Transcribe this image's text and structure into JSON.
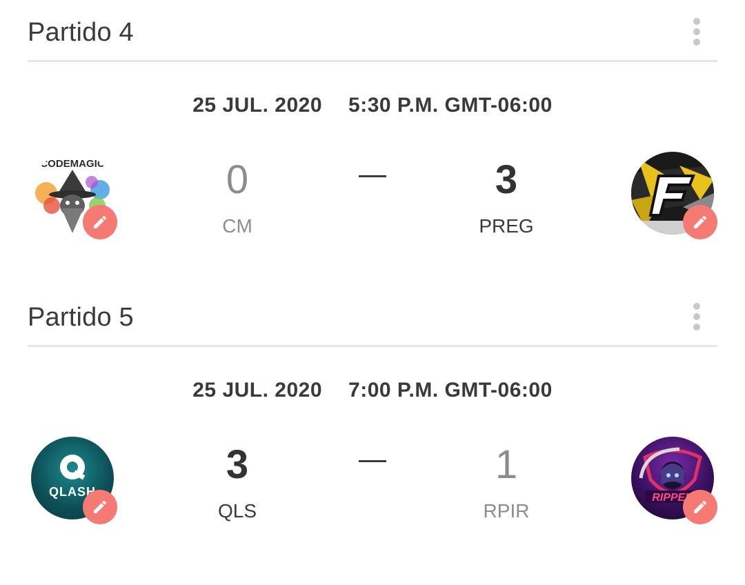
{
  "matches": [
    {
      "title": "Partido 4",
      "date": "25 JUL. 2020",
      "time": "5:30 P.M. GMT-06:00",
      "home": {
        "abbr": "CM",
        "score": "0",
        "logo_text": "CODEMAGIC",
        "result": "lose"
      },
      "away": {
        "abbr": "PREG",
        "score": "3",
        "logo_text": "F",
        "result": "win"
      }
    },
    {
      "title": "Partido 5",
      "date": "25 JUL. 2020",
      "time": "7:00 P.M. GMT-06:00",
      "home": {
        "abbr": "QLS",
        "score": "3",
        "logo_text": "QLASH",
        "result": "win"
      },
      "away": {
        "abbr": "RPIR",
        "score": "1",
        "logo_text": "RIPPER",
        "result": "lose"
      }
    }
  ],
  "icons": {
    "menu": "more-vert-icon",
    "edit": "pencil-icon"
  },
  "colors": {
    "edit_button": "#f67a74",
    "divider": "#e6e6e6",
    "winner_text": "#333333",
    "loser_text": "#8c8c8c"
  }
}
